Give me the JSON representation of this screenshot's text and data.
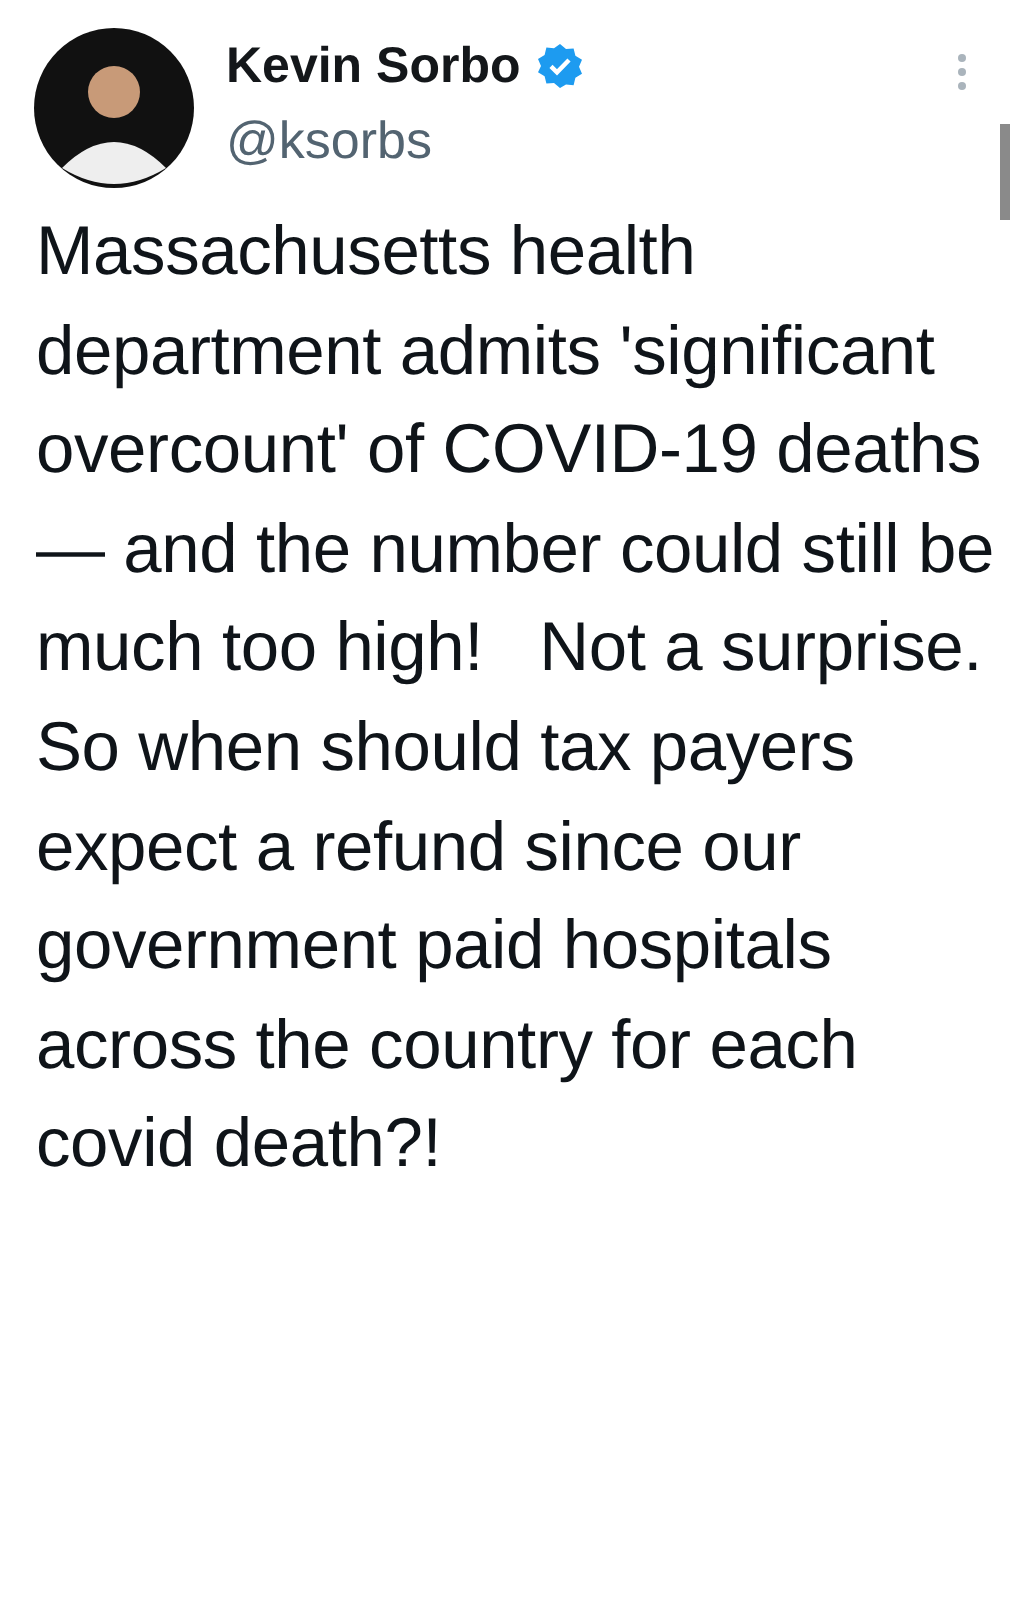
{
  "author": {
    "name": "Kevin Sorbo",
    "verified": true,
    "handle": "@ksorbs"
  },
  "tweet": {
    "text": "Massachusetts health department admits 'significant overcount' of COVID-19 deaths — and the number could still be much too high!   Not a surprise. So when should tax payers expect a refund since our government paid hospitals across the country for each covid death?!"
  }
}
